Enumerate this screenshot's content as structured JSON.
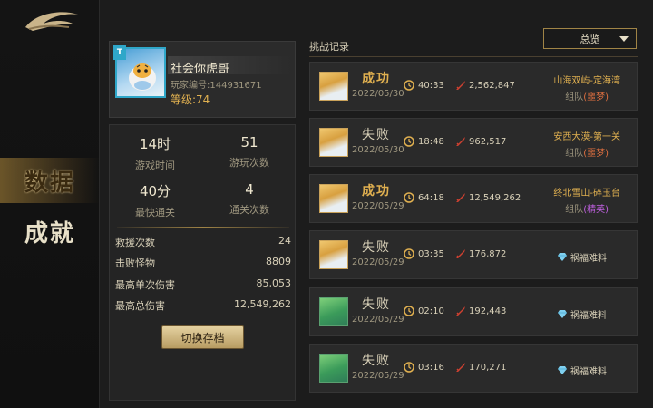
{
  "nav": {
    "items": [
      {
        "label": "数据",
        "active": true
      },
      {
        "label": "成就",
        "active": false
      }
    ]
  },
  "profile": {
    "name": "社会你虎哥",
    "player_id": "玩家编号:144931671",
    "level": "等级:74",
    "badge": "T"
  },
  "stats": {
    "play_time": {
      "value": "14时",
      "label": "游戏时间"
    },
    "play_count": {
      "value": "51",
      "label": "游玩次数"
    },
    "fastest": {
      "value": "40分",
      "label": "最快通关"
    },
    "clear_count": {
      "value": "4",
      "label": "通关次数"
    },
    "rows": [
      {
        "label": "救援次数",
        "value": "24"
      },
      {
        "label": "击败怪物",
        "value": "8809"
      },
      {
        "label": "最高单次伤害",
        "value": "85,053"
      },
      {
        "label": "最高总伤害",
        "value": "12,549,262"
      }
    ],
    "switch_button": "切换存档"
  },
  "records": {
    "title": "挑战记录",
    "filter": "总览",
    "items": [
      {
        "result": "成功",
        "win": true,
        "date": "2022/05/30",
        "time": "40:33",
        "damage": "2,562,847",
        "stage": "山海双屿-定海湾",
        "mode": "组队",
        "tag": "(噩梦)",
        "tag_kind": "red",
        "avatar": "tiger"
      },
      {
        "result": "失败",
        "win": false,
        "date": "2022/05/30",
        "time": "18:48",
        "damage": "962,517",
        "stage": "安西大漠-第一关",
        "mode": "组队",
        "tag": "(噩梦)",
        "tag_kind": "red",
        "avatar": "tiger"
      },
      {
        "result": "成功",
        "win": true,
        "date": "2022/05/29",
        "time": "64:18",
        "damage": "12,549,262",
        "stage": "终北雪山-碎玉台",
        "mode": "组队",
        "tag": "(精英)",
        "tag_kind": "purple",
        "avatar": "tiger"
      },
      {
        "result": "失败",
        "win": false,
        "date": "2022/05/29",
        "time": "03:35",
        "damage": "176,872",
        "special": "祸福难料",
        "avatar": "tiger"
      },
      {
        "result": "失败",
        "win": false,
        "date": "2022/05/29",
        "time": "02:10",
        "damage": "192,443",
        "special": "祸福难料",
        "avatar": "green"
      },
      {
        "result": "失败",
        "win": false,
        "date": "2022/05/29",
        "time": "03:16",
        "damage": "170,271",
        "special": "祸福难料",
        "avatar": "green"
      }
    ]
  },
  "colors": {
    "gold": "#e0b050",
    "accent_line": "#a08446",
    "panel": "#2a2a2a",
    "tag_red": "#e07040",
    "tag_purple": "#c060e0"
  }
}
